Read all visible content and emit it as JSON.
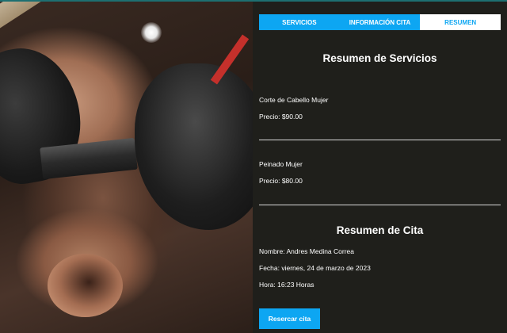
{
  "tabs": [
    {
      "label": "Servicios",
      "active": false
    },
    {
      "label": "Información Cita",
      "active": false
    },
    {
      "label": "Resumen",
      "active": true
    }
  ],
  "summary": {
    "services_title": "Resumen de Servicios",
    "services": [
      {
        "name": "Corte de Cabello Mujer",
        "price": "Precio: $90.00"
      },
      {
        "name": "Peinado Mujer",
        "price": "Precio: $80.00"
      }
    ],
    "appointment_title": "Resumen de Cita",
    "name": "Nombre: Andres Medina Correa",
    "date": "Fecha: viernes, 24 de marzo de 2023",
    "time": "Hora: 16:23 Horas"
  },
  "actions": {
    "reserve_label": "Resercar cita"
  },
  "colors": {
    "accent": "#0da6f2",
    "panel_bg": "#1f1f1b",
    "text": "#ffffff"
  },
  "image": {
    "semantic": "barber-shaving-man-photo"
  }
}
